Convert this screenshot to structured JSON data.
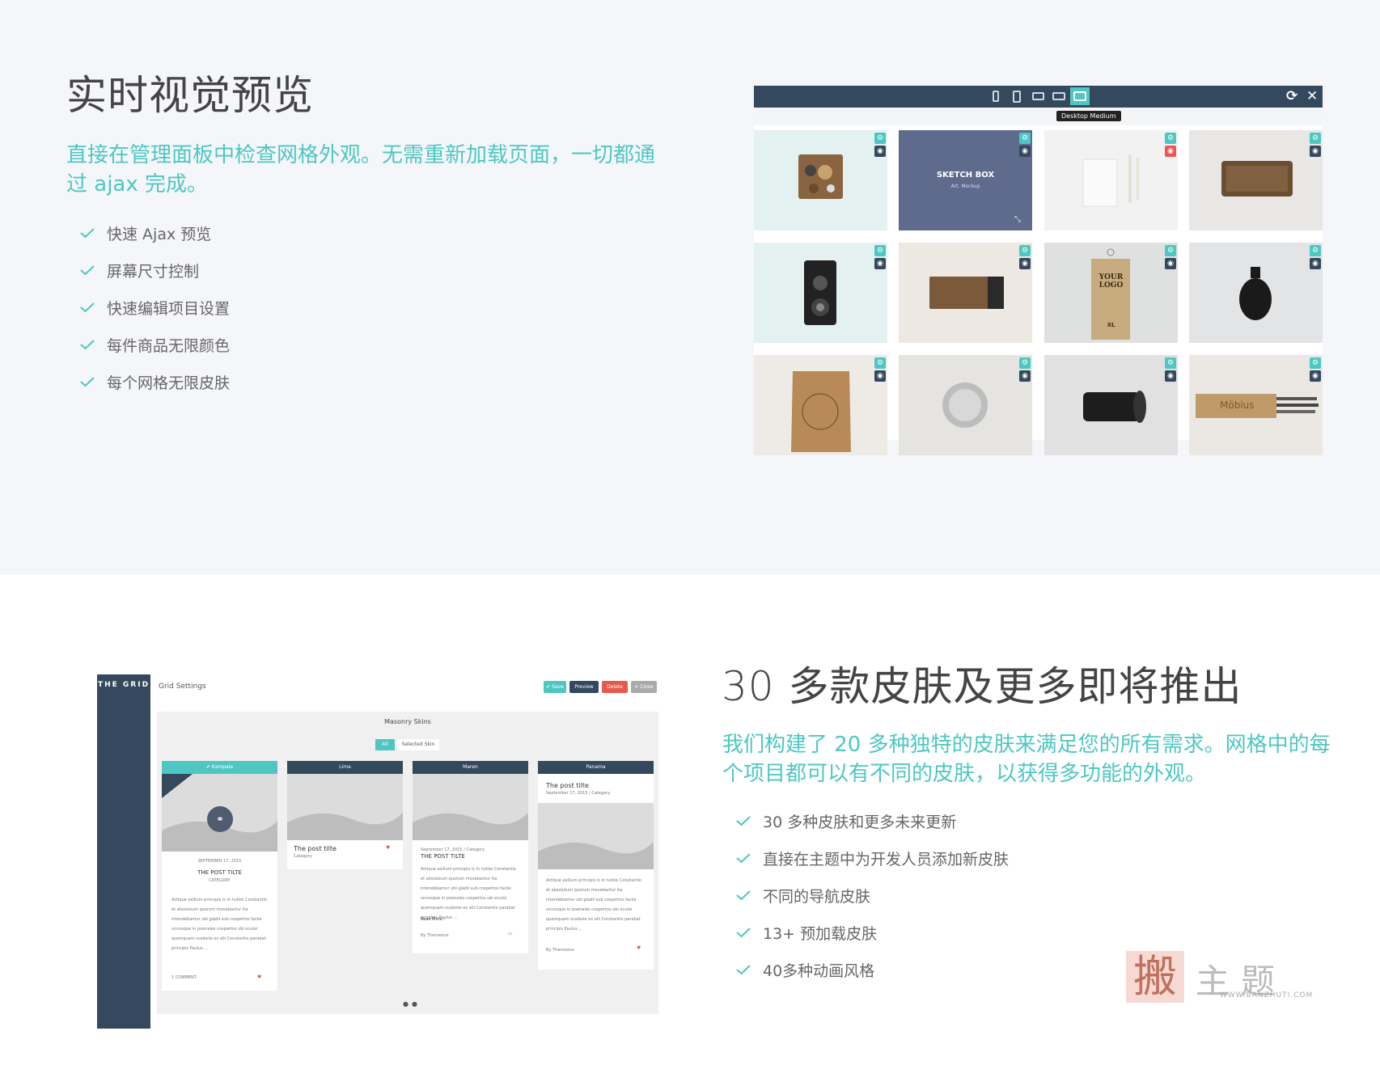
{
  "section1": {
    "title": "实时视觉预览",
    "lead_line1": "直接在管理面板中检查网格外观。无需重新加载页面，一切都通",
    "lead_line2": "过 ajax 完成。",
    "features": [
      "快速 Ajax 预览",
      "屏幕尺寸控制",
      "快速编辑项目设置",
      "每件商品无限颜色",
      "每个网格无限皮肤"
    ],
    "preview": {
      "tooltip": "Desktop Medium",
      "sketch_title": "SKETCH BOX",
      "sketch_sub": "Art. Mockup",
      "tag_line1": "YOUR",
      "tag_line2": "LOGO",
      "tag_size": "XL",
      "mobius": "Möbius"
    }
  },
  "section2": {
    "title": "30 多款皮肤及更多即将推出",
    "lead_line1": "我们构建了 20 多种独特的皮肤来满足您的所有需求。网格中的每",
    "lead_line2": "个项目都可以有不同的皮肤，以获得多功能的外观。",
    "features": [
      "30 多种皮肤和更多未来更新",
      "直接在主题中为开发人员添加新皮肤",
      "不同的导航皮肤",
      "13+ 预加载皮肤",
      "40多种动画风格"
    ],
    "admin": {
      "logo": "THE GRID",
      "header": "Grid Settings",
      "btn_save": "✔ Save",
      "btn_preview": "Preview",
      "btn_delete": "Delete",
      "btn_close": "× Close",
      "panel_title": "Masonry Skins",
      "tab_all": "All",
      "tab_selected": "Selected Skin",
      "cards": [
        {
          "name": "✔ Kampala",
          "date": "SEPTEMBER 17, 2015",
          "title": "THE POST TILTE",
          "cat": "CATEGORY",
          "body": "Actique exilium principis is in nullos Constantio et absolutum quorum movebantur Ita intendebantur ubi gladii sub cospertos facile uncosque in poenales cospertos ubi eculei quemquam scaleste ex alli Constantio parabat principis Paulus ...",
          "footer": "1 COMMENT"
        },
        {
          "name": "Lima",
          "title": "The post tilte",
          "cat": "Category"
        },
        {
          "name": "Maren",
          "date": "September 17, 2015  /  Category",
          "title": "THE POST TILTE",
          "body": "Actique exilium principis is in nullos Constantio et absolutum quorum movebantur ita intendebantur ubi gladii sub cospertos facile uncosque in poenales cospertos ubi eculei quemquam scaleste ex alli Constantio parabat principis Paulus ...",
          "more": "Read More ›",
          "by": "By Themeone"
        },
        {
          "name": "Panama",
          "title": "The post tilte",
          "date": "September 17, 2015  |  Category",
          "body": "Actique exilium principis is in nullos Constantio et absolutum quorum movebantur ita intendebantur ubi gladii sub cospertos facile uncosque in poenales cospertos ubi eculei quemquam scaleste ex alli Constantio parabat principis Paulus ...",
          "by": "By Themeone"
        }
      ]
    }
  },
  "watermark": {
    "box": "搬",
    "text": "主题",
    "url": "WWW.BANZHUTI.COM"
  },
  "colors": {
    "accent": "#4ec7c2",
    "dark": "#34495e",
    "delete": "#e55a4e",
    "bg_light": "#f5f6fa"
  }
}
